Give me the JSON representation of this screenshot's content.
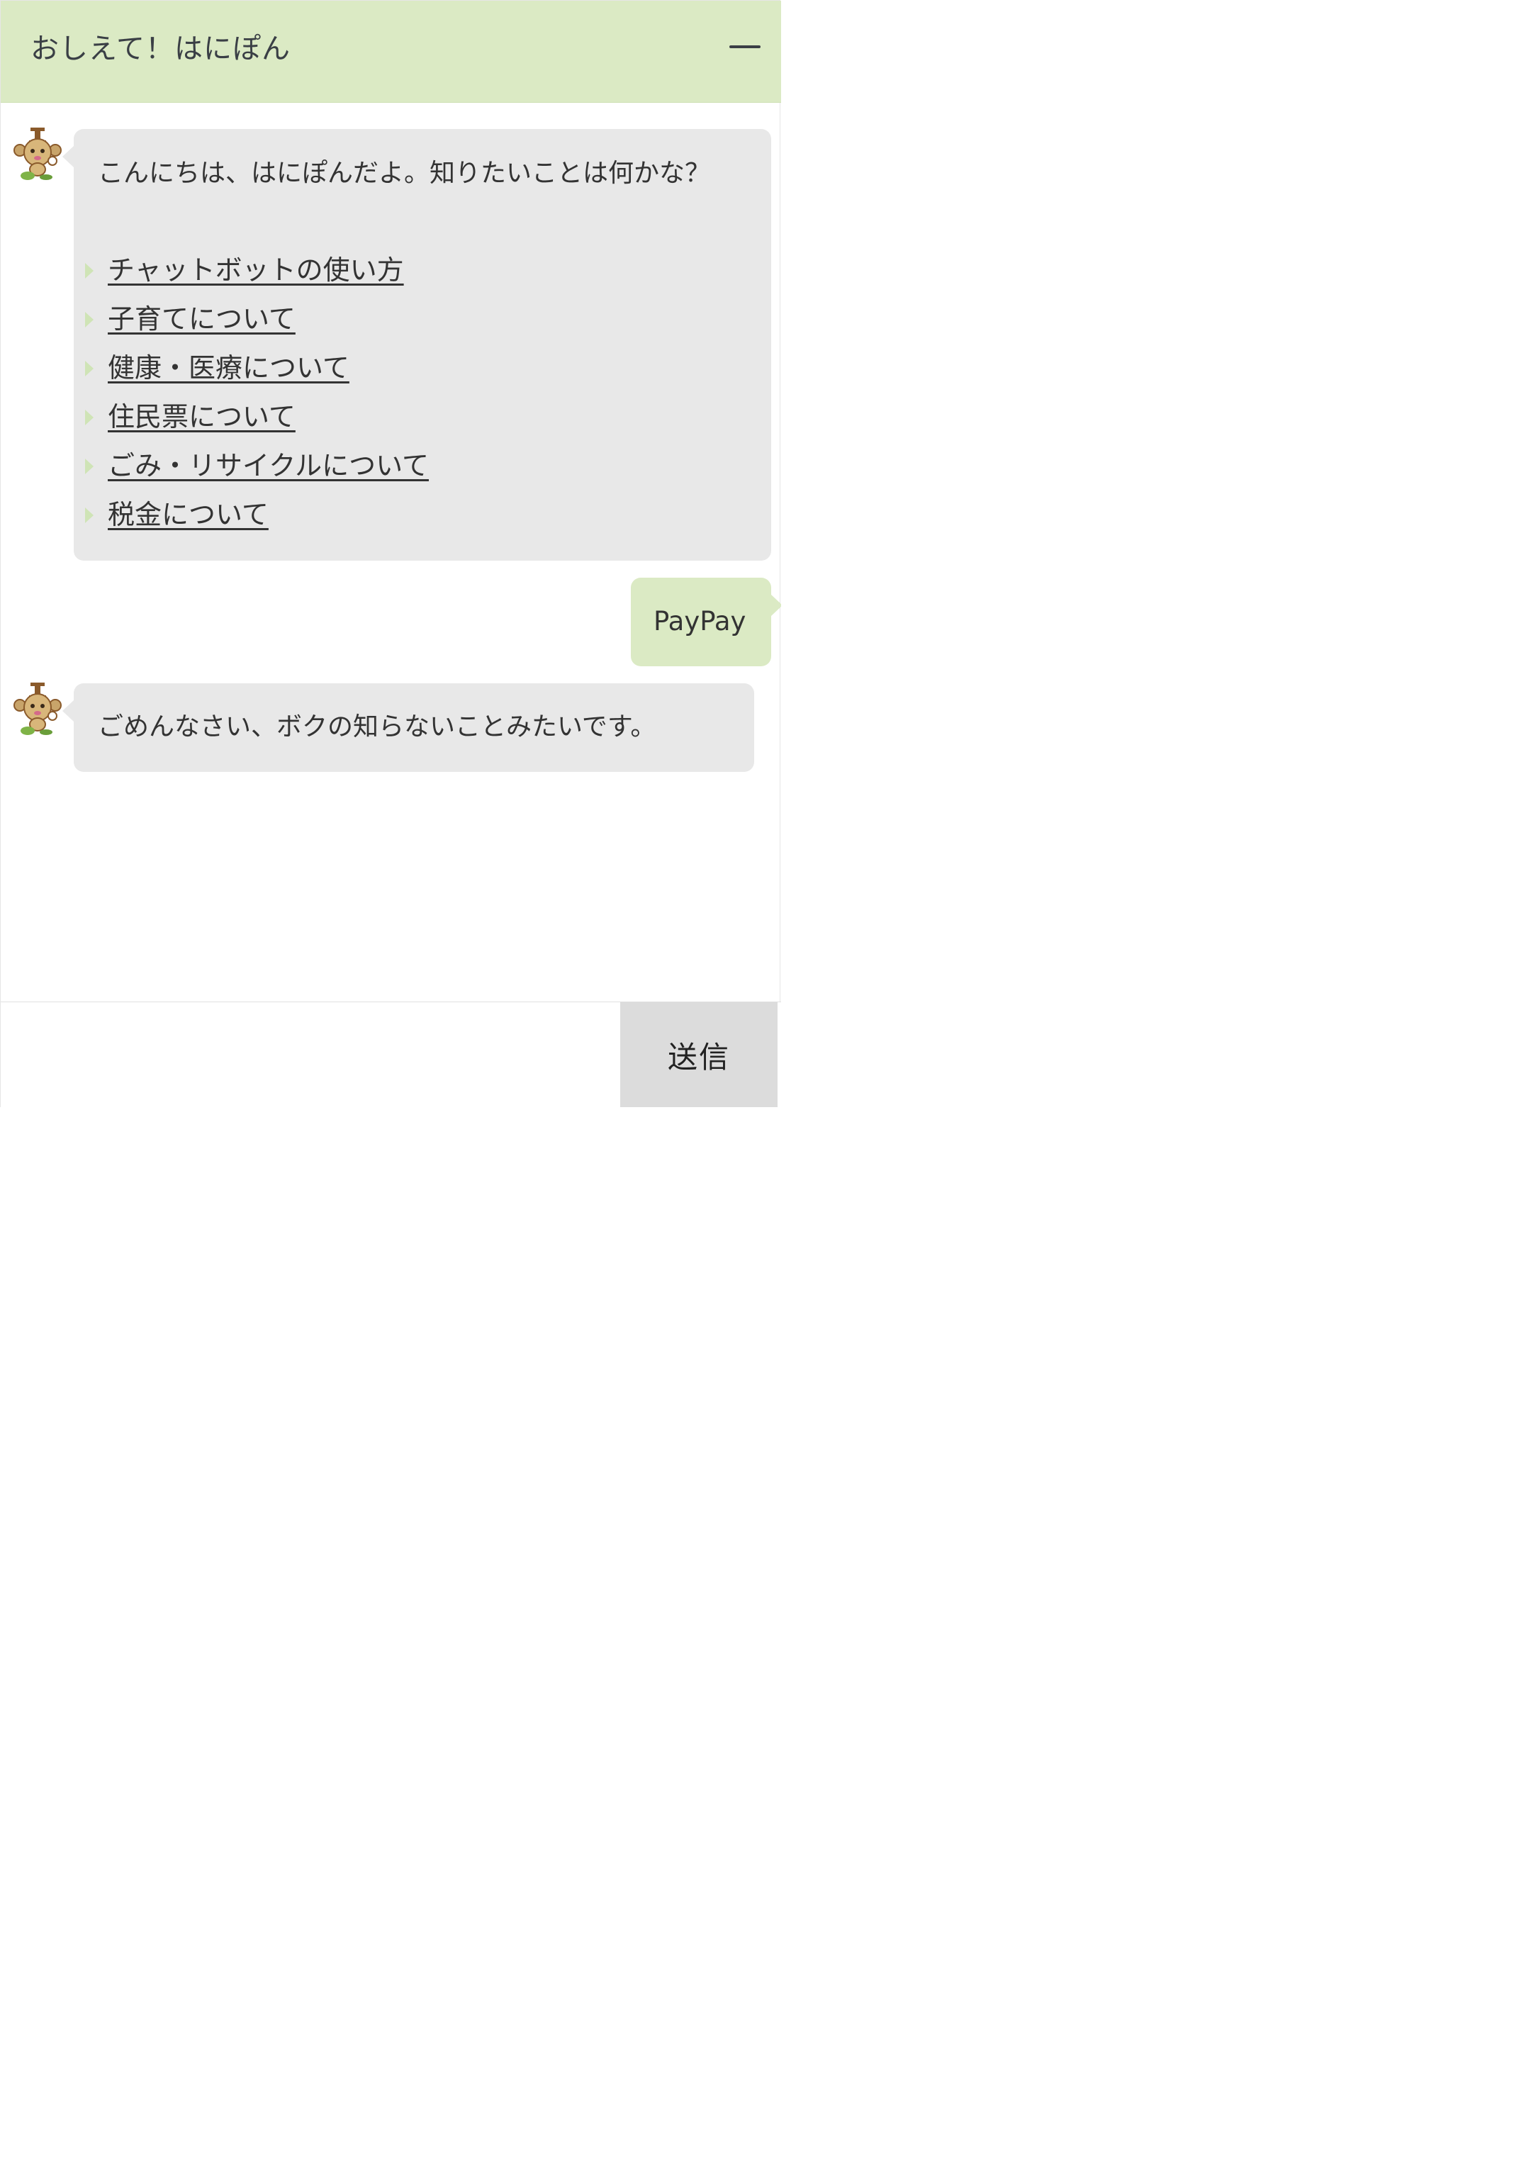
{
  "header": {
    "title": "おしえて！はにぽん",
    "minimize_icon": "minimize-icon"
  },
  "messages": [
    {
      "sender": "bot",
      "avatar_icon": "mascot-avatar-icon",
      "text": "こんにちは、はにぽんだよ。知りたいことは何かな？",
      "quick_links": [
        "チャットボットの使い方",
        "子育てについて",
        "健康・医療について",
        "住民票について",
        "ごみ・リサイクルについて",
        "税金について"
      ]
    },
    {
      "sender": "user",
      "text": "PayPay"
    },
    {
      "sender": "bot",
      "avatar_icon": "mascot-avatar-icon",
      "text": "ごめんなさい、ボクの知らないことみたいです。"
    }
  ],
  "input": {
    "value": "",
    "placeholder": ""
  },
  "send_button": {
    "label": "送信"
  },
  "colors": {
    "header_background": "#dbeac4",
    "bot_bubble": "#e8e8e8",
    "user_bubble": "#dbeac4",
    "send_button_background": "#dcdcdc",
    "link_arrow": "#cfe4b6",
    "text": "#333333"
  }
}
